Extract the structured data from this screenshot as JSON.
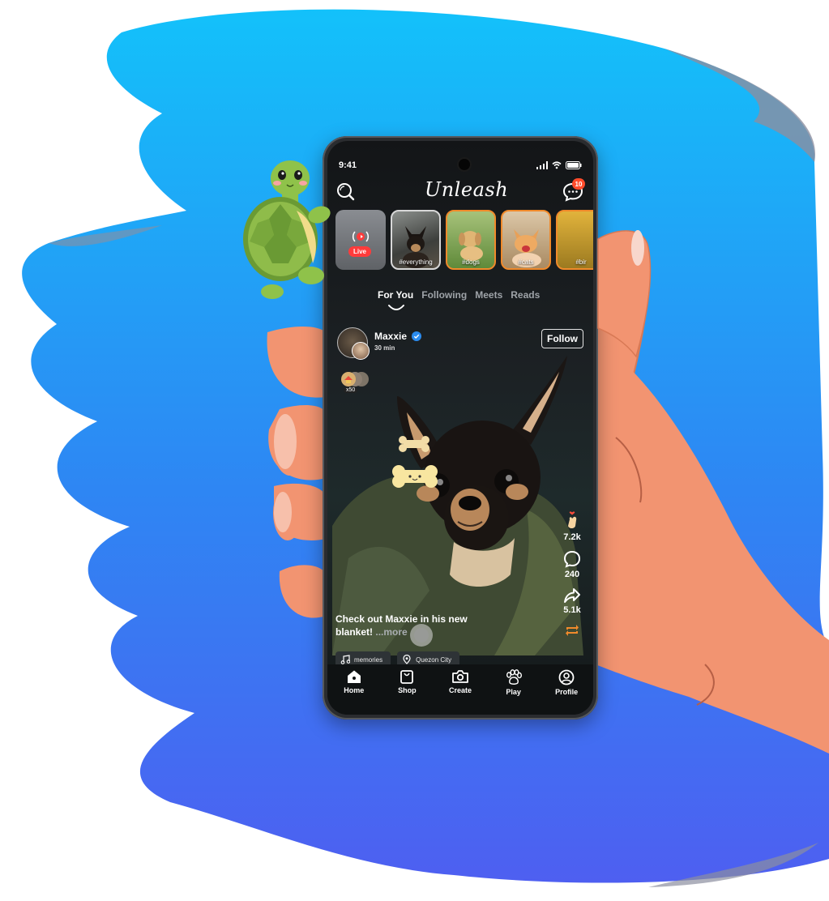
{
  "status_bar": {
    "time": "9:41"
  },
  "app": {
    "logo_text": "Unleash",
    "message_badge": "10"
  },
  "stories": [
    {
      "label": "Live",
      "type": "live"
    },
    {
      "label": "#everything",
      "type": "photo"
    },
    {
      "label": "#dogs",
      "type": "photo"
    },
    {
      "label": "#cats",
      "type": "photo"
    },
    {
      "label": "#bir",
      "type": "photo"
    }
  ],
  "tabs": [
    "For You",
    "Following",
    "Meets",
    "Reads"
  ],
  "active_tab": "For You",
  "post": {
    "author": "Maxxie",
    "time": "30 min",
    "follow_label": "Follow",
    "reaction_count": "x50",
    "caption": "Check out Maxxie in his new blanket!",
    "more_label": "...more",
    "likes": "7.2k",
    "comments": "240",
    "shares": "5.1k",
    "music": "memories",
    "location": "Quezon City"
  },
  "nav": [
    "Home",
    "Shop",
    "Create",
    "Play",
    "Profile"
  ],
  "colors": {
    "accent": "#f08a2b",
    "badge": "#ff4b2b",
    "brush_top": "#13bdf7",
    "brush_bottom": "#4a66f2",
    "skin": "#f29471"
  }
}
